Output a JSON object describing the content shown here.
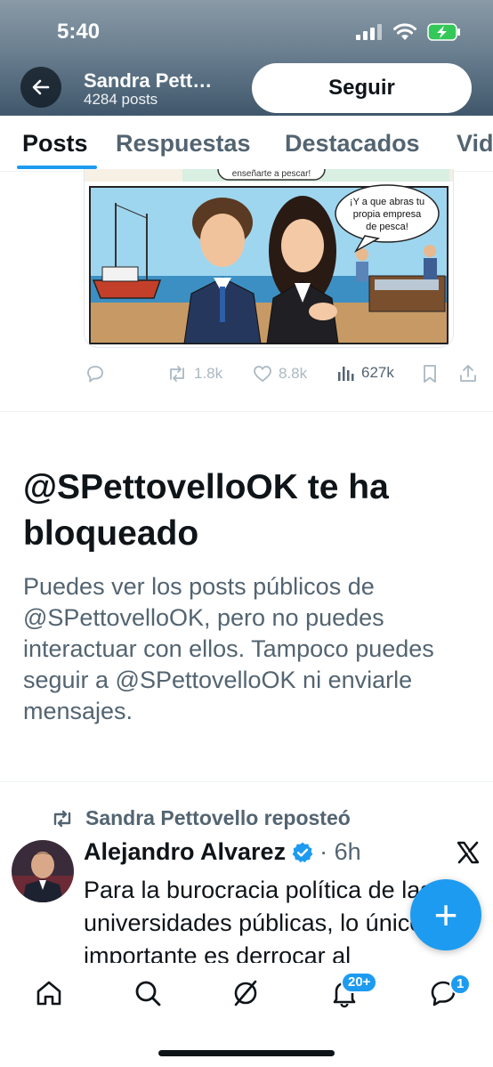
{
  "status_bar": {
    "time": "5:40"
  },
  "header": {
    "profile_name": "Sandra Pett…",
    "post_count": "4284 posts",
    "follow_label": "Seguir"
  },
  "tabs": [
    {
      "label": "Posts",
      "active": true
    },
    {
      "label": "Respuestas"
    },
    {
      "label": "Destacados"
    },
    {
      "label": "Vid"
    }
  ],
  "top_post": {
    "image": {
      "bubble_top_text": "enseñarte a pescar!",
      "bubble_text_line1": "¡Y a que abras tu",
      "bubble_text_line2": "propia empresa",
      "bubble_text_line3": "de pesca!"
    },
    "actions": {
      "retweets": "1.8k",
      "likes": "8.8k",
      "views": "627k"
    }
  },
  "blocked_notice": {
    "title": "@SPettovelloOK te ha bloqueado",
    "body": "Puedes ver los posts públicos de @SPettovelloOK, pero no puedes interactuar con ellos. Tampoco puedes seguir a @SPettovelloOK ni enviarle mensajes."
  },
  "retweet": {
    "reposted_by": "Sandra Pettovello reposteó",
    "author_name": "Alejandro Alvarez",
    "time_ago": "· 6h",
    "text": "Para la burocracia política de las universidades públicas, lo único importante es derrocar al"
  },
  "bottom_nav": {
    "notifications_badge": "20+",
    "messages_badge": "1"
  },
  "colors": {
    "accent": "#1d9bf0",
    "header_bg": "#5d7386",
    "secondary_text": "#536471"
  }
}
